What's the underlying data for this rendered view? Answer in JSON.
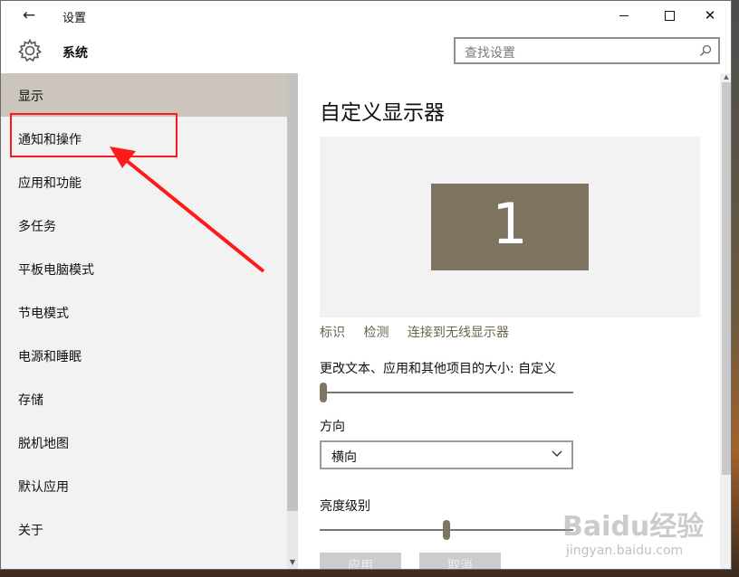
{
  "window": {
    "title": "设置"
  },
  "titlebar": {
    "back_icon": "back-arrow-icon",
    "controls": [
      "minimize-icon",
      "maximize-icon",
      "close-icon"
    ]
  },
  "header": {
    "section_icon": "gear-icon",
    "section_title": "系统",
    "search": {
      "placeholder": "查找设置",
      "icon": "search-icon"
    }
  },
  "sidebar": {
    "items": [
      {
        "label": "显示",
        "selected": true
      },
      {
        "label": "通知和操作",
        "selected": false
      },
      {
        "label": "应用和功能",
        "selected": false
      },
      {
        "label": "多任务",
        "selected": false
      },
      {
        "label": "平板电脑模式",
        "selected": false
      },
      {
        "label": "节电模式",
        "selected": false
      },
      {
        "label": "电源和睡眠",
        "selected": false
      },
      {
        "label": "存储",
        "selected": false
      },
      {
        "label": "脱机地图",
        "selected": false
      },
      {
        "label": "默认应用",
        "selected": false
      },
      {
        "label": "关于",
        "selected": false
      }
    ]
  },
  "main": {
    "heading": "自定义显示器",
    "monitor_number": "1",
    "links": {
      "identify": "标识",
      "detect": "检测",
      "wireless": "连接到无线显示器"
    },
    "scale": {
      "label": "更改文本、应用和其他项目的大小: 自定义",
      "value_percent": 0
    },
    "orientation": {
      "label": "方向",
      "value": "横向"
    },
    "brightness": {
      "label": "亮度级别",
      "value_percent": 50
    },
    "buttons": {
      "apply": "应用",
      "cancel": "取消"
    }
  },
  "watermark": {
    "logo": "Baidu经验",
    "url": "jingyan.baidu.com"
  },
  "colors": {
    "accent": "#7f7461",
    "selected_bg": "#cbc5bd",
    "annotation": "#ff1a1a"
  }
}
